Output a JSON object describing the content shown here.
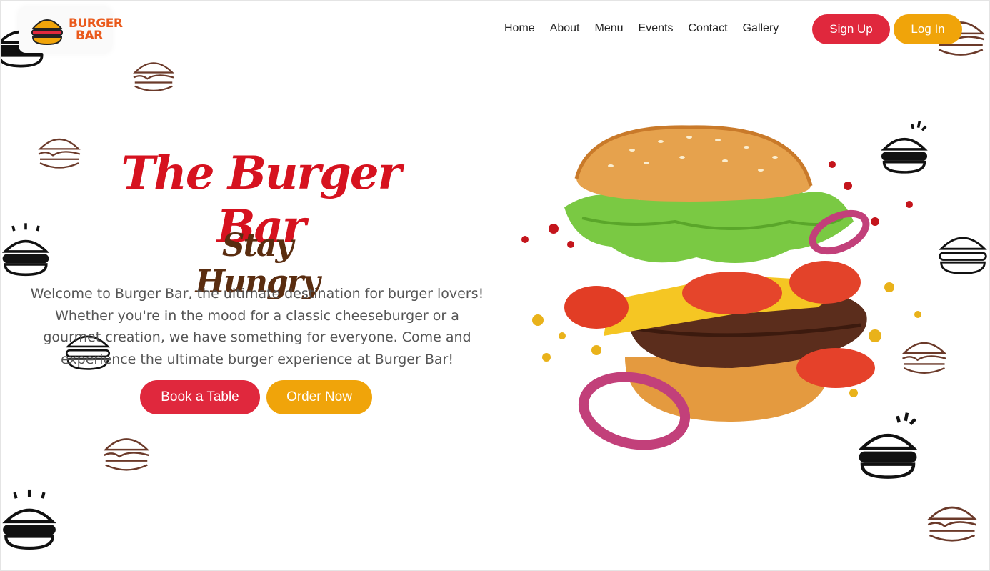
{
  "brand": {
    "line1": "BURGER",
    "line2": "BAR",
    "color": "#ea5a1c"
  },
  "nav": {
    "items": [
      "Home",
      "About",
      "Menu",
      "Events",
      "Contact",
      "Gallery"
    ]
  },
  "auth": {
    "signup_label": "Sign Up",
    "login_label": "Log In"
  },
  "hero": {
    "title": "The Burger Bar",
    "subtitle": "Stay Hungry",
    "description": "Welcome to Burger Bar, the ultimate destination for burger lovers! Whether you're in the mood for a classic cheeseburger or a gourmet creation, we have something for everyone. Come and experience the ultimate burger experience at Burger Bar!",
    "book_label": "Book a Table",
    "order_label": "Order Now"
  },
  "colors": {
    "red": "#e0283d",
    "yellow": "#f0a40a",
    "title": "#d6121f",
    "subtitle": "#5a2d10"
  },
  "icons": [
    "burger-logo-icon",
    "burger-doodle-icon",
    "burger-hero-image"
  ]
}
